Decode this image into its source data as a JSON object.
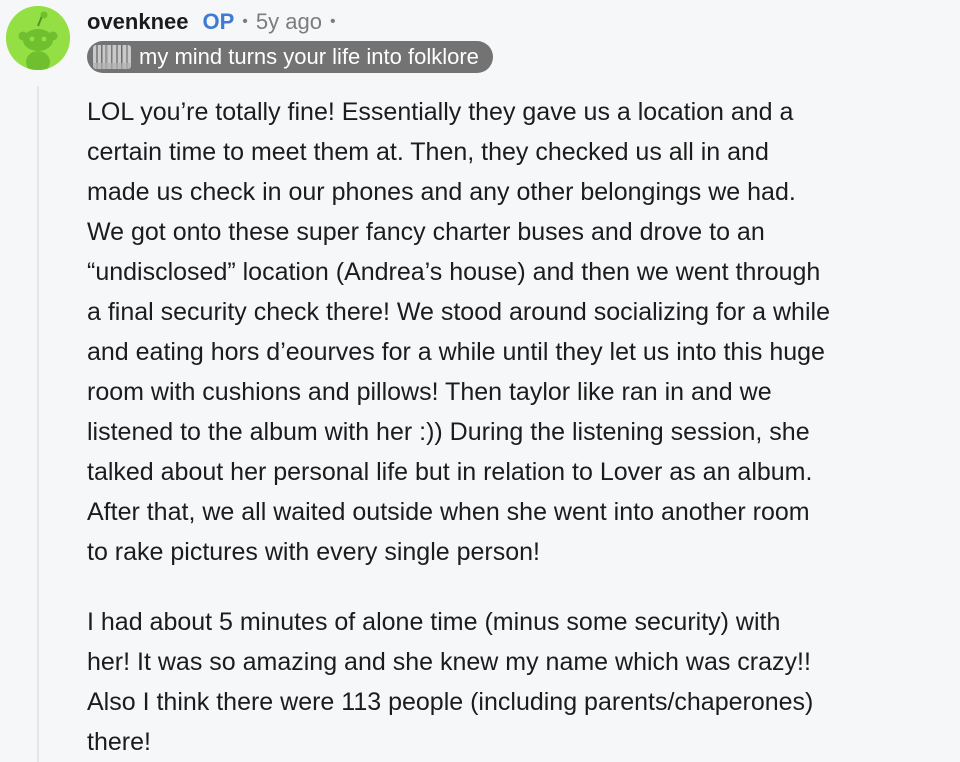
{
  "comment": {
    "author": "ovenknee",
    "op_badge": "OP",
    "separator": "•",
    "timestamp": "5y ago",
    "flair": {
      "text": "my mind turns your life into folklore",
      "emoji_icon": "folklore-forest-emoji"
    },
    "avatar_icon": "reddit-snoo-avatar-icon",
    "paragraphs": [
      "LOL you’re totally fine! Essentially they gave us a location and a\ncertain time to meet them at. Then, they checked us all in and\nmade us check in our phones and any other belongings we had.\nWe got onto these super fancy charter buses and drove to an\n“undisclosed” location (Andrea’s house) and then we went through\na final security check there! We stood around socializing for a while\nand eating hors d’eourves for a while until they let us into this huge\nroom with cushions and pillows! Then taylor like ran in and we\nlistened to the album with her :)) During the listening session, she\ntalked about her personal life but in relation to Lover as an album.\nAfter that, we all waited outside when she went into another room\nto rake pictures with every single person!",
      "I had about 5 minutes of alone time (minus some security) with\nher! It was so amazing and she knew my name which was crazy!!\nAlso I think there were 113 people (including parents/chaperones)\nthere!"
    ]
  },
  "colors": {
    "background": "#f6f7f8",
    "avatar_bg": "#94e044",
    "op": "#3e7bd6",
    "flair_bg": "#737373",
    "thread_line": "#e4e6e8",
    "meta_text": "#7c7c7c"
  }
}
